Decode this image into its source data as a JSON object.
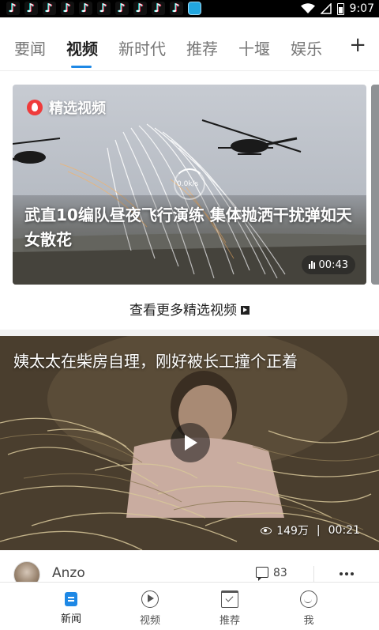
{
  "status_bar": {
    "time": "9:07",
    "notification_icons": [
      "tiktok-icon",
      "tiktok-icon",
      "tiktok-icon",
      "tiktok-icon",
      "tiktok-icon",
      "tiktok-icon",
      "tiktok-icon",
      "tiktok-icon",
      "tiktok-icon",
      "tiktok-icon",
      "app-icon"
    ],
    "system_icons": [
      "wifi-icon",
      "signal-icon",
      "battery-icon"
    ]
  },
  "tabs": {
    "items": [
      "要闻",
      "视频",
      "新时代",
      "推荐",
      "十堰",
      "娱乐"
    ],
    "active_index": 1,
    "add_label": "+",
    "accent_color": "#1e88e5"
  },
  "featured": {
    "badge": "精选视频",
    "badge_icon": "fire-icon",
    "title": "武直10编队昼夜飞行演练 集体抛洒干扰弹如天女散花",
    "loading_rate": "0.0k/s",
    "duration": "00:43",
    "more_link": "查看更多精选视频"
  },
  "video": {
    "title": "姨太太在柴房自理，刚好被长工撞个正着",
    "views": "149万",
    "separator": "|",
    "duration": "00:21"
  },
  "author": {
    "name": "Anzo",
    "comments": "83"
  },
  "bottom_nav": {
    "items": [
      {
        "label": "新闻",
        "icon": "news-icon"
      },
      {
        "label": "视频",
        "icon": "video-icon"
      },
      {
        "label": "推荐",
        "icon": "recommend-icon"
      },
      {
        "label": "我",
        "icon": "me-icon"
      }
    ],
    "active_index": 0
  }
}
